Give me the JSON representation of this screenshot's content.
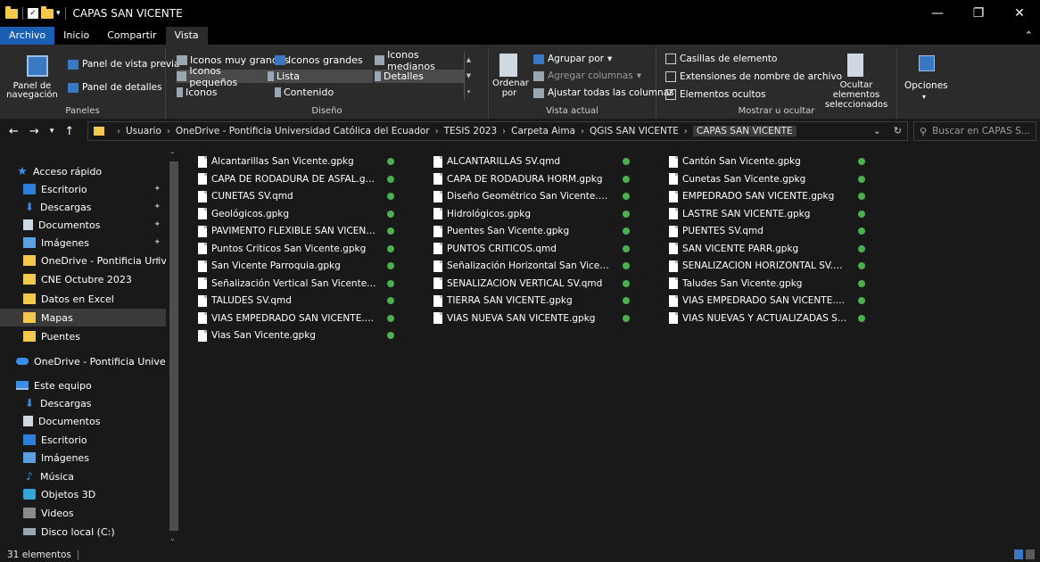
{
  "window": {
    "title": "CAPAS SAN VICENTE",
    "minimize": "—",
    "restore": "❐",
    "close": "✕"
  },
  "tabs": [
    "Archivo",
    "Inicio",
    "Compartir",
    "Vista"
  ],
  "ribbon": {
    "paneles": {
      "label": "Paneles",
      "nav_pane": "Panel de navegación",
      "preview": "Panel de vista previa",
      "details": "Panel de detalles"
    },
    "diseno": {
      "label": "Diseño",
      "items": [
        "Iconos muy grandes",
        "Iconos grandes",
        "Iconos medianos",
        "Iconos pequeños",
        "Lista",
        "Detalles",
        "Iconos",
        "Contenido"
      ]
    },
    "vista_actual": {
      "label": "Vista actual",
      "sort": "Ordenar por",
      "group": "Agrupar por",
      "add_columns": "Agregar columnas",
      "fit_columns": "Ajustar todas las columnas"
    },
    "mostrar": {
      "label": "Mostrar u ocultar",
      "checkboxes": "Casillas de elemento",
      "extensions": "Extensiones de nombre de archivo",
      "hidden": "Elementos ocultos",
      "hide_selected": "Ocultar elementos seleccionados"
    },
    "opciones": "Opciones"
  },
  "address": {
    "crumbs": [
      "Usuario",
      "OneDrive - Pontificia Universidad Católica del Ecuador",
      "TESIS 2023",
      "Carpeta Aima",
      "QGIS SAN VICENTE",
      "CAPAS SAN VICENTE"
    ],
    "search_placeholder": "Buscar en CAPAS S..."
  },
  "nav": {
    "quick_access": "Acceso rápido",
    "quick": [
      "Escritorio",
      "Descargas",
      "Documentos",
      "Imágenes",
      "OneDrive - Pontificia Unive",
      "CNE Octubre 2023",
      "Datos en Excel",
      "Mapas",
      "Puentes"
    ],
    "onedrive": "OneDrive - Pontificia Universida",
    "this_pc": "Este equipo",
    "pc": [
      "Descargas",
      "Documentos",
      "Escritorio",
      "Imágenes",
      "Música",
      "Objetos 3D",
      "Videos",
      "Disco local (C:)"
    ]
  },
  "files": {
    "col1": [
      "Alcantarillas San Vicente.gpkg",
      "CAPA DE RODADURA DE ASFAL.gpkg",
      "CUNETAS SV.qmd",
      "Geológicos.gpkg",
      "PAVIMENTO FLEXIBLE SAN VICENTE...",
      "Puntos Criticos San Vicente.gpkg",
      "San Vicente Parroquia.gpkg",
      "Señalización Vertical San Vicente.gp...",
      "TALUDES SV.qmd",
      "VIAS EMPEDRADO SAN VICENTE.q...",
      "Vias San Vicente.gpkg"
    ],
    "col2": [
      "ALCANTARILLAS SV.qmd",
      "CAPA DE RODADURA HORM.gpkg",
      "Diseño Geométrico San Vicente.gpkg",
      "Hidrológicos.gpkg",
      "Puentes San Vicente.gpkg",
      "PUNTOS CRITICOS.qmd",
      "Señalización Horizontal San Vicente...",
      "SEÑALIZACION VERTICAL SV.qmd",
      "TIERRA SAN VICENTE.gpkg",
      "VIAS NUEVA SAN VICENTE.gpkg"
    ],
    "col3": [
      "Cantón San Vicente.gpkg",
      "Cunetas San Vicente.gpkg",
      "EMPEDRADO SAN VICENTE.gpkg",
      "LASTRE SAN VICENTE.gpkg",
      "PUENTES SV.qmd",
      "SAN VICENTE PARR.gpkg",
      "SEÑALIZACIÓN HORIZONTAL SV.q...",
      "Taludes San Vicente.gpkg",
      "VIAS EMPEDRADO SAN VICENTE.gp...",
      "VIAS NUEVAS Y ACTUALIZADAS SV...."
    ]
  },
  "status": {
    "count": "31 elementos"
  }
}
